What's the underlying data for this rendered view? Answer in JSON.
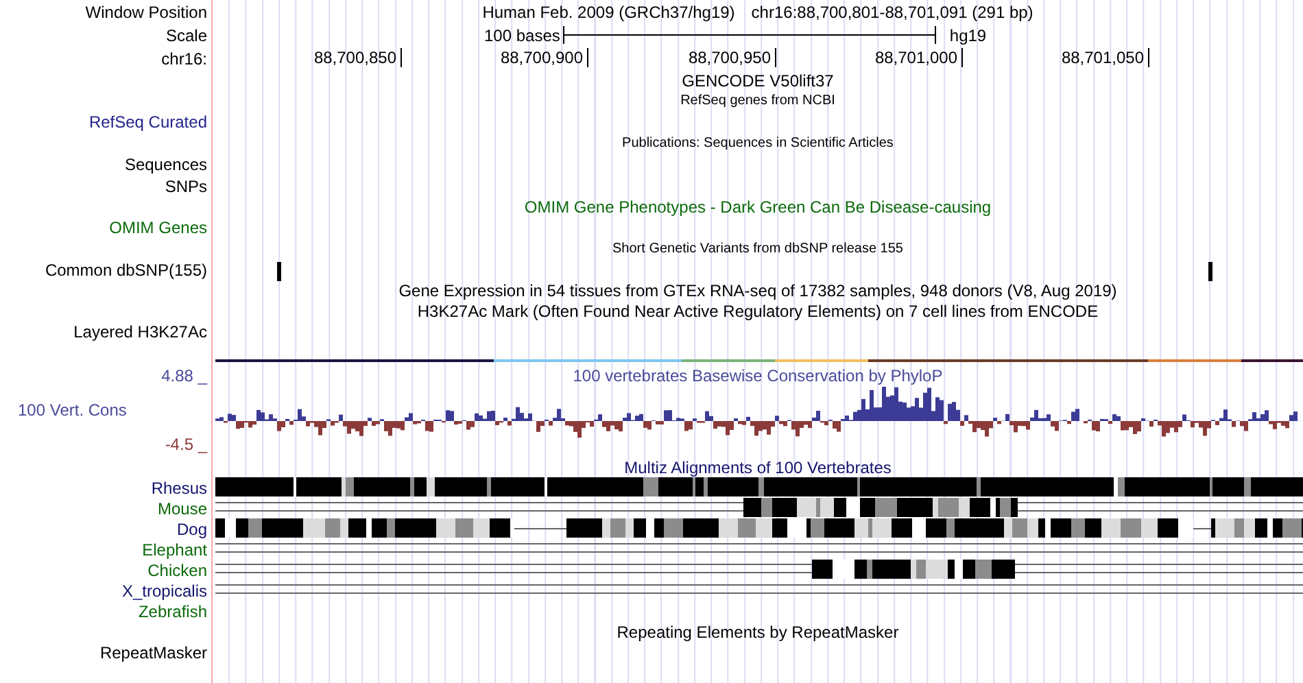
{
  "header": {
    "label": "Window Position",
    "assembly_title": "Human Feb. 2009 (GRCh37/hg19)",
    "position": "chr16:88,700,801-88,701,091 (291 bp)"
  },
  "scale": {
    "label": "Scale",
    "bar_label": "100 bases",
    "assembly": "hg19"
  },
  "ruler": {
    "label": "chr16:",
    "ticks": [
      "88,700,850",
      "88,700,900",
      "88,700,950",
      "88,701,000",
      "88,701,050"
    ]
  },
  "tracks": [
    {
      "kind": "title",
      "text": "GENCODE V50lift37"
    },
    {
      "kind": "note",
      "text": "RefSeq genes from NCBI"
    },
    {
      "kind": "label",
      "label": "RefSeq Curated",
      "color": "#24248c"
    },
    {
      "kind": "note",
      "text": "Publications: Sequences in Scientific Articles"
    },
    {
      "kind": "label",
      "label": "Sequences",
      "color": "#000000"
    },
    {
      "kind": "label",
      "label": "SNPs",
      "color": "#000000"
    },
    {
      "kind": "title",
      "text": "OMIM Gene Phenotypes - Dark Green Can Be Disease-causing",
      "color": "#0b6a0b"
    },
    {
      "kind": "label",
      "label": "OMIM Genes",
      "color": "#0b6a0b"
    },
    {
      "kind": "note",
      "text": "Short Genetic Variants from dbSNP release 155"
    },
    {
      "kind": "snp",
      "label": "Common dbSNP(155)",
      "color": "#000000"
    },
    {
      "kind": "title",
      "text": "Gene Expression in 54 tissues from GTEx RNA-seq of 17382 samples, 948 donors (V8, Aug 2019)"
    },
    {
      "kind": "title",
      "text": "H3K27Ac Mark (Often Found Near Active Regulatory Elements) on 7 cell lines from ENCODE"
    },
    {
      "kind": "label",
      "label": "Layered H3K27Ac",
      "color": "#000000"
    },
    {
      "kind": "color-bar"
    },
    {
      "kind": "wiggle",
      "label": "100 Vert. Cons",
      "color": "#4a4a9a",
      "text": "100 vertebrates Basewise Conservation by PhyloP",
      "max": "4.88 _",
      "min": "-4.5 _"
    },
    {
      "kind": "title",
      "text": "Multiz Alignments of 100 Vertebrates",
      "color": "#14146e"
    },
    {
      "kind": "alignment",
      "label": "Rhesus",
      "color": "#14146e"
    },
    {
      "kind": "alignment",
      "label": "Mouse",
      "color": "#0b6a0b"
    },
    {
      "kind": "alignment",
      "label": "Dog",
      "color": "#14146e"
    },
    {
      "kind": "alignment",
      "label": "Elephant",
      "color": "#0b6a0b"
    },
    {
      "kind": "alignment",
      "label": "Chicken",
      "color": "#0b6a0b"
    },
    {
      "kind": "alignment",
      "label": "X_tropicalis",
      "color": "#14146e"
    },
    {
      "kind": "alignment",
      "label": "Zebrafish",
      "color": "#0b6a0b"
    },
    {
      "kind": "title",
      "text": "Repeating Elements by RepeatMasker"
    },
    {
      "kind": "label",
      "label": "RepeatMasker",
      "color": "#000000"
    }
  ]
}
